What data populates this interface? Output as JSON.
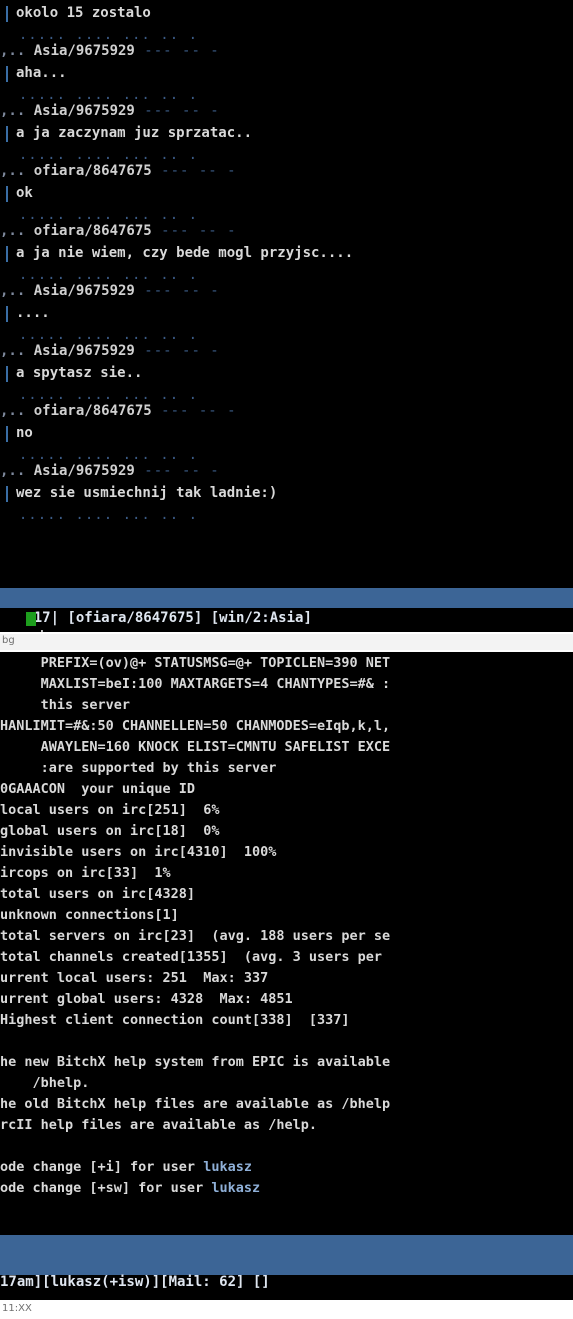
{
  "chat": {
    "messages": [
      {
        "nick": "",
        "text": "okolo 15 zostalo"
      },
      {
        "nick": "Asia/9675929",
        "text": "aha..."
      },
      {
        "nick": "Asia/9675929",
        "text": "a ja zaczynam juz sprzatac.."
      },
      {
        "nick": "ofiara/8647675",
        "text": "ok"
      },
      {
        "nick": "ofiara/8647675",
        "text": "a ja nie wiem, czy bede mogl przyjsc...."
      },
      {
        "nick": "Asia/9675929",
        "text": "...."
      },
      {
        "nick": "Asia/9675929",
        "text": "a spytasz sie.."
      },
      {
        "nick": "ofiara/8647675",
        "text": "no"
      },
      {
        "nick": "Asia/9675929",
        "text": "wez sie usmiechnij tak ladnie:)"
      }
    ],
    "separator_dots": "..... .... ... .. .",
    "header_tail": "--- -- -",
    "status_line": "17| [ofiara/8647675] [win/2:Asia]",
    "input_text": "|",
    "window_label": "bg"
  },
  "server": {
    "lines": [
      "     PREFIX=(ov)@+ STATUSMSG=@+ TOPICLEN=390 NET",
      "     MAXLIST=beI:100 MAXTARGETS=4 CHANTYPES=#& :",
      "     this server",
      "HANLIMIT=#&:50 CHANNELLEN=50 CHANMODES=eIqb,k,l,",
      "     AWAYLEN=160 KNOCK ELIST=CMNTU SAFELIST EXCE",
      "     :are supported by this server",
      "0GAAACON  your unique ID",
      "local users on irc[251]  6%",
      "global users on irc[18]  0%",
      "invisible users on irc[4310]  100%",
      "ircops on irc[33]  1%",
      "total users on irc[4328]",
      "unknown connections[1]",
      "total servers on irc[23]  (avg. 188 users per se",
      "total channels created[1355]  (avg. 3 users per",
      "urrent local users: 251  Max: 337",
      "urrent global users: 4328  Max: 4851",
      "Highest client connection count[338]  [337]",
      "",
      "he new BitchX help system from EPIC is available",
      "    /bhelp.",
      "he old BitchX help files are available as /bhelp",
      "rcII help files are available as /help.",
      "",
      "ode change [+i] for user lukasz",
      "ode change [+sw] for user lukasz"
    ],
    "status_line1": "17am][lukasz(+isw)][Mail: 62] []",
    "status_line2": " ??]",
    "window_label": "11:XX"
  }
}
